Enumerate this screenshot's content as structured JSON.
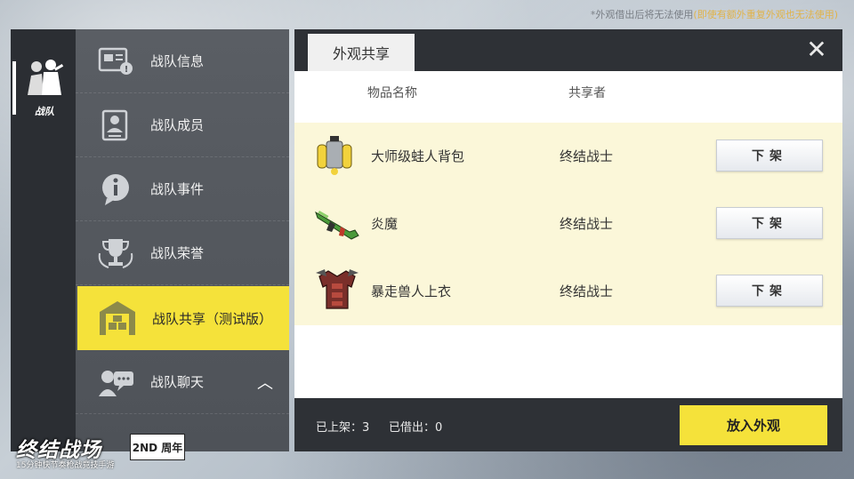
{
  "notice": {
    "main": "*外观借出后将无法使用",
    "paren": "(即使有额外重复外观也无法使用)"
  },
  "sidebar": {
    "team_label": "战队"
  },
  "menu": {
    "items": [
      {
        "label": "战队信息",
        "icon": "info-card-icon"
      },
      {
        "label": "战队成员",
        "icon": "member-card-icon"
      },
      {
        "label": "战队事件",
        "icon": "info-bubble-icon"
      },
      {
        "label": "战队荣誉",
        "icon": "trophy-icon"
      },
      {
        "label": "战队共享（测试版）",
        "icon": "warehouse-icon"
      },
      {
        "label": "战队聊天",
        "icon": "chat-icon"
      }
    ],
    "active_index": 4
  },
  "panel": {
    "tab_label": "外观共享",
    "col_item": "物品名称",
    "col_owner": "共享者",
    "rows": [
      {
        "name": "大师级蛙人背包",
        "owner": "终结战士",
        "action": "下架",
        "icon": "backpack-icon"
      },
      {
        "name": "炎魔",
        "owner": "终结战士",
        "action": "下架",
        "icon": "rifle-icon"
      },
      {
        "name": "暴走兽人上衣",
        "owner": "终结战士",
        "action": "下架",
        "icon": "armor-icon"
      }
    ],
    "footer": {
      "listed": "已上架：3",
      "borrowed": "已借出：0",
      "put_button": "放入外观"
    }
  },
  "logo": {
    "title": "终结战场",
    "badge": "2ND 周年",
    "subtitle": "15分钟快节奏枪战竞技手游"
  },
  "colors": {
    "accent": "#f5e23a",
    "dark": "#2e3136",
    "row_bg": "#fbf7d9"
  }
}
